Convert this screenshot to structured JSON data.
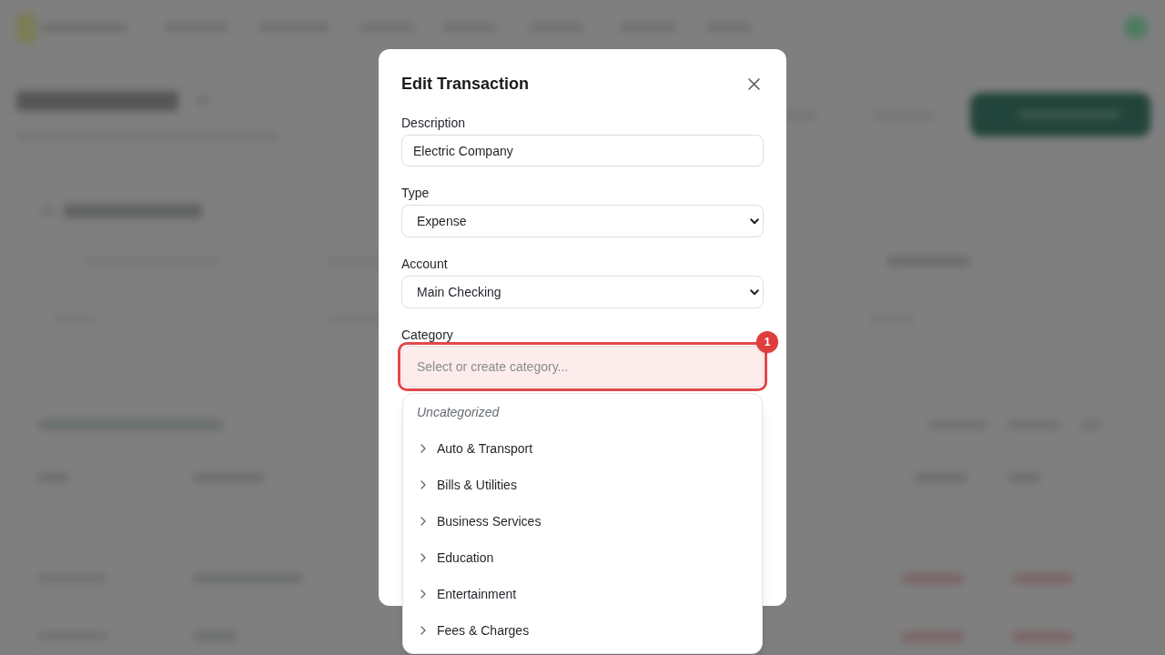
{
  "dialog": {
    "title": "Edit Transaction",
    "fields": [
      {
        "label": "Description",
        "kind": "text",
        "value": "Electric Company"
      },
      {
        "label": "Type",
        "kind": "select",
        "value": "Expense"
      },
      {
        "label": "Account",
        "kind": "select",
        "value": "Main Checking"
      },
      {
        "label": "Category",
        "kind": "combobox",
        "placeholder": "Select or create category...",
        "annotation": "1"
      }
    ]
  },
  "category_menu": {
    "items": [
      {
        "label": "Uncategorized",
        "kind": "none"
      },
      {
        "label": "Auto & Transport",
        "kind": "group",
        "expanded": false
      },
      {
        "label": "Bills & Utilities",
        "kind": "group",
        "expanded": false
      },
      {
        "label": "Business Services",
        "kind": "group",
        "expanded": false
      },
      {
        "label": "Education",
        "kind": "group",
        "expanded": false
      },
      {
        "label": "Entertainment",
        "kind": "group",
        "expanded": false
      },
      {
        "label": "Fees & Charges",
        "kind": "group",
        "expanded": false
      }
    ]
  }
}
